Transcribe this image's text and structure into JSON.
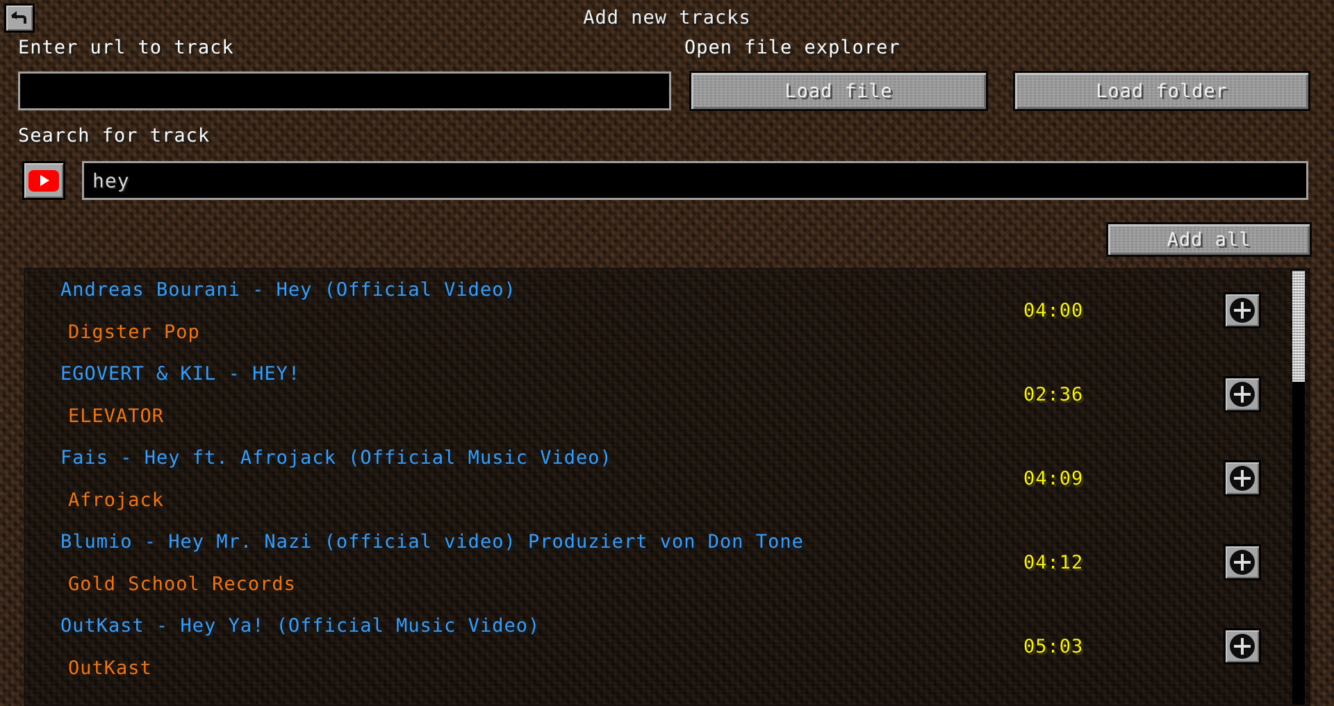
{
  "window": {
    "title": "Add new tracks"
  },
  "nav": {
    "back_icon": "back-arrow-icon"
  },
  "url_section": {
    "label": "Enter url to track",
    "input_value": "",
    "input_placeholder": ""
  },
  "explorer_section": {
    "label": "Open file explorer",
    "load_file_label": "Load file",
    "load_folder_label": "Load folder"
  },
  "search_section": {
    "label": "Search for track",
    "source_icon": "youtube-icon",
    "input_value": "hey",
    "input_placeholder": ""
  },
  "actions": {
    "add_all_label": "Add all"
  },
  "results": {
    "add_icon": "plus-icon",
    "tracks": [
      {
        "title": "Andreas Bourani - Hey (Official Video)",
        "channel": "Digster Pop",
        "duration": "04:00"
      },
      {
        "title": "EGOVERT & KIL - HEY!",
        "channel": "ELEVATOR",
        "duration": "02:36"
      },
      {
        "title": "Fais - Hey ft. Afrojack (Official Music Video)",
        "channel": "Afrojack",
        "duration": "04:09"
      },
      {
        "title": "Blumio - Hey Mr. Nazi (official video) Produziert von Don Tone",
        "channel": "Gold School Records",
        "duration": "04:12"
      },
      {
        "title": "OutKast - Hey Ya! (Official Music Video)",
        "channel": "OutKast",
        "duration": "05:03"
      }
    ]
  },
  "colors": {
    "background": "#2a1b12",
    "title_text": "#f2f2f2",
    "track_title": "#3e9bf0",
    "track_channel": "#e8761e",
    "track_duration": "#f8ef18",
    "button_face": "#9b9b9b",
    "youtube_red": "#ff0000"
  }
}
